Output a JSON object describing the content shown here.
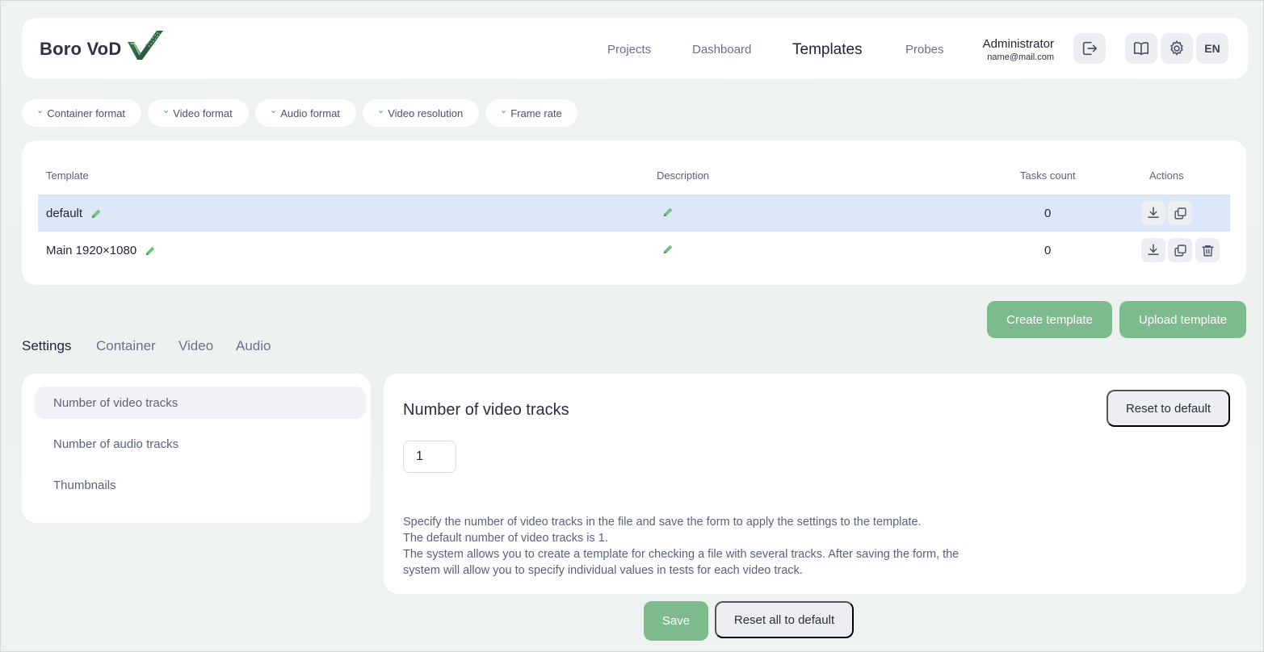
{
  "app": {
    "logo_text": "Boro VoD"
  },
  "nav": {
    "projects": "Projects",
    "dashboard": "Dashboard",
    "templates": "Templates",
    "probes": "Probes"
  },
  "user": {
    "name": "Administrator",
    "email": "name@mail.com"
  },
  "header_buttons": {
    "lang": "EN"
  },
  "filters": [
    "Container format",
    "Video format",
    "Audio format",
    "Video resolution",
    "Frame rate"
  ],
  "table": {
    "columns": [
      "Template",
      "Description",
      "Tasks count",
      "Actions"
    ],
    "rows": [
      {
        "template": "default",
        "tasks_count": "0",
        "selected": true
      },
      {
        "template": "Main 1920×1080",
        "tasks_count": "0",
        "selected": false
      }
    ]
  },
  "buttons": {
    "create_template": "Create template",
    "upload_template": "Upload template",
    "reset_to_default": "Reset to default",
    "save": "Save",
    "reset_all": "Reset all to default"
  },
  "tabs": [
    "Settings",
    "Container",
    "Video",
    "Audio"
  ],
  "settings_menu": [
    "Number of video tracks",
    "Number of audio tracks",
    "Thumbnails"
  ],
  "settings_panel": {
    "title": "Number of video tracks",
    "value": "1",
    "help": [
      "Specify the number of video tracks in the file and save the form to apply the settings to the template.",
      "The default number of video tracks is 1.",
      "The system allows you to create a template for checking a file with several tracks. After saving the form, the",
      "system will allow you to specify individual values in tests for each video track."
    ]
  },
  "colors": {
    "accent_green": "#7dbb8d",
    "selected_row": "#dce8fa",
    "chevron_blue": "#4a86d8"
  }
}
